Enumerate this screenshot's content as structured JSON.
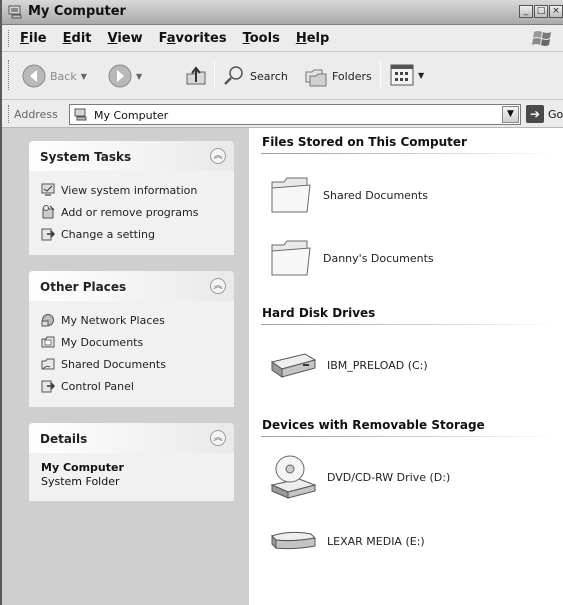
{
  "window": {
    "title": "My Computer",
    "controls": [
      "_",
      "□",
      "×"
    ]
  },
  "menu": {
    "items": [
      {
        "ul": "F",
        "rest": "ile"
      },
      {
        "ul": "E",
        "rest": "dit"
      },
      {
        "ul": "V",
        "rest": "iew"
      },
      {
        "pre": "F",
        "ul": "a",
        "rest": "vorites"
      },
      {
        "ul": "T",
        "rest": "ools"
      },
      {
        "ul": "H",
        "rest": "elp"
      }
    ]
  },
  "toolbar": {
    "back_label": "Back",
    "search_label": "Search",
    "folders_label": "Folders"
  },
  "address": {
    "label": "Address",
    "value": "My Computer",
    "go_label": "Go"
  },
  "tasks": {
    "system": {
      "title": "System Tasks",
      "items": [
        {
          "label": "View system information",
          "icon": "system-info-icon"
        },
        {
          "label": "Add or remove programs",
          "icon": "add-remove-icon"
        },
        {
          "label": "Change a setting",
          "icon": "control-panel-icon"
        }
      ]
    },
    "other": {
      "title": "Other Places",
      "items": [
        {
          "label": "My Network Places",
          "icon": "network-places-icon"
        },
        {
          "label": "My Documents",
          "icon": "documents-folder-icon"
        },
        {
          "label": "Shared Documents",
          "icon": "shared-folder-icon"
        },
        {
          "label": "Control Panel",
          "icon": "control-panel-icon"
        }
      ]
    },
    "details": {
      "title": "Details",
      "name": "My Computer",
      "type": "System Folder"
    }
  },
  "content": {
    "groups": [
      {
        "title": "Files Stored on This Computer",
        "items": [
          "Shared Documents",
          "Danny's Documents"
        ]
      },
      {
        "title": "Hard Disk Drives",
        "items": [
          "IBM_PRELOAD (C:)"
        ]
      },
      {
        "title": "Devices with Removable Storage",
        "items": [
          "DVD/CD-RW Drive (D:)",
          "LEXAR MEDIA (E:)"
        ]
      }
    ]
  }
}
